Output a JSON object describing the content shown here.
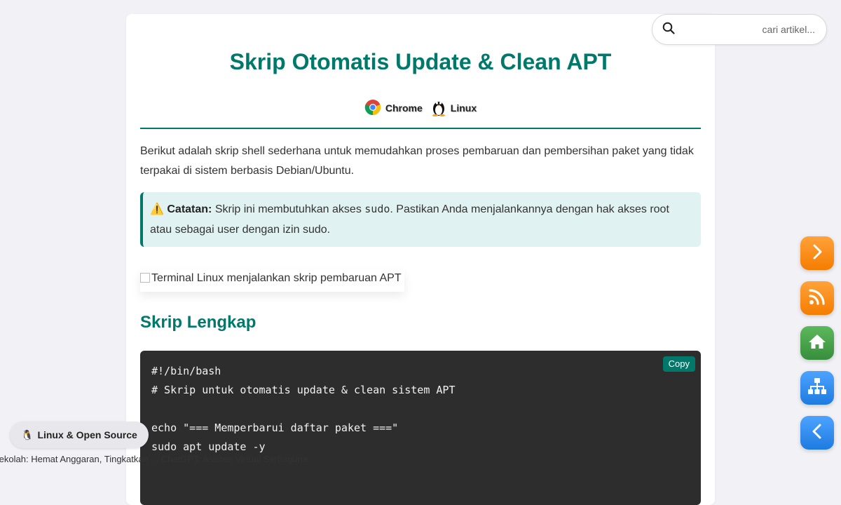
{
  "article": {
    "title": "Skrip Otomatis Update & Clean APT",
    "tags": [
      {
        "label": "Chrome",
        "icon": "chrome-icon"
      },
      {
        "label": "Linux",
        "icon": "tux-penguin-icon"
      }
    ],
    "intro": "Berikut adalah skrip shell sederhana untuk memudahkan proses pembaruan dan pembersihan paket yang tidak terpakai di sistem berbasis Debian/Ubuntu.",
    "note": {
      "icon": "⚠️",
      "label": "Catatan:",
      "text_before": " Skrip ini membutuhkan akses ",
      "code": "sudo",
      "text_after": ". Pastikan Anda menjalankannya dengan hak akses root atau sebagai user dengan izin sudo."
    },
    "image_alt": "Terminal Linux menjalankan skrip pembaruan APT",
    "section_heading": "Skrip Lengkap",
    "code": "#!/bin/bash\n# Skrip untuk otomatis update & clean sistem APT\n\necho \"=== Memperbarui daftar paket ===\"\nsudo apt update -y\n",
    "copy_label": "Copy"
  },
  "search": {
    "placeholder": "cari artikel..."
  },
  "badge": {
    "icon": "🐧",
    "label": "Linux & Open Source"
  },
  "ticker": {
    "text": "Sekolah: Hemat Anggaran, Tingkatkan ... ChatGPT: Asisten Virtual Serbaguna"
  },
  "colors": {
    "accent": "#00796b",
    "note_bg": "#e0f2f1",
    "code_bg": "#2d2d2d"
  }
}
